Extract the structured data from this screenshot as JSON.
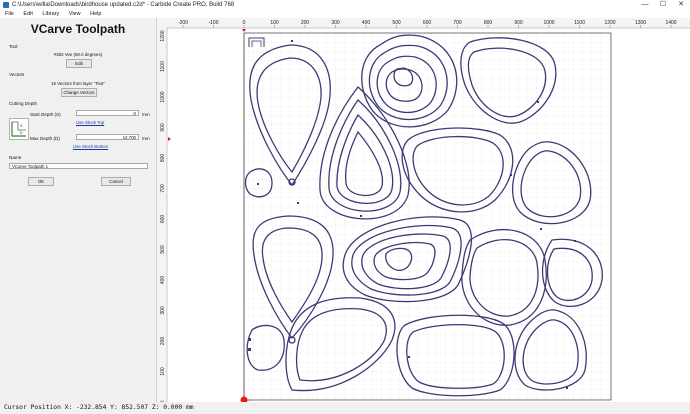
{
  "window": {
    "title": "C:\\Users\\willa\\Downloads\\birdhouse updated.c2d* - Carbide Create PRO, Build 768",
    "minimize": "—",
    "maximize": "☐",
    "close": "✕"
  },
  "menu": [
    "File",
    "Edit",
    "Library",
    "View",
    "Help"
  ],
  "panel": {
    "title": "VCarve Toolpath",
    "tool_label": "Tool",
    "tool_value": "#302 Vee (60.0 degrees)",
    "edit_button": "Edit",
    "vectors_label": "Vectors",
    "vectors_value": "15 Vectors from layer \"Text\"",
    "change_vectors_button": "Change Vectors",
    "cutting_depth_label": "Cutting Depth",
    "start_depth_label": "Start Depth (S)",
    "start_depth_value": "0",
    "start_depth_unit": "mm",
    "use_stock_top_link": "Use Stock Top",
    "max_depth_label": "Max Depth (D)",
    "max_depth_value": "12.700",
    "max_depth_unit": "mm",
    "use_stock_bottom_link": "Use Stock Bottom",
    "name_label": "Name",
    "name_value": "VCarve Toolpath 1",
    "ok_button": "OK",
    "cancel_button": "Cancel",
    "s_glyph": "S",
    "d_glyph": "D"
  },
  "ruler": {
    "x_labels": [
      "-200",
      "-100",
      "0",
      "100",
      "200",
      "300",
      "400",
      "500",
      "600",
      "700",
      "800",
      "900",
      "1000",
      "1100",
      "1200",
      "1300",
      "1400"
    ],
    "y_labels": [
      "1200",
      "1100",
      "1000",
      "900",
      "800",
      "700",
      "600",
      "500",
      "400",
      "300",
      "200",
      "100",
      "0"
    ]
  },
  "colors": {
    "shape_stroke": "#3c3a76",
    "grid_line": "#d9d9d9",
    "ruler_marker": "#cc2222",
    "link": "#1a3aa8"
  },
  "status_bar": {
    "cursor": "Cursor Position X: -232.854 Y: 852.507 Z: 0.000 mm"
  }
}
